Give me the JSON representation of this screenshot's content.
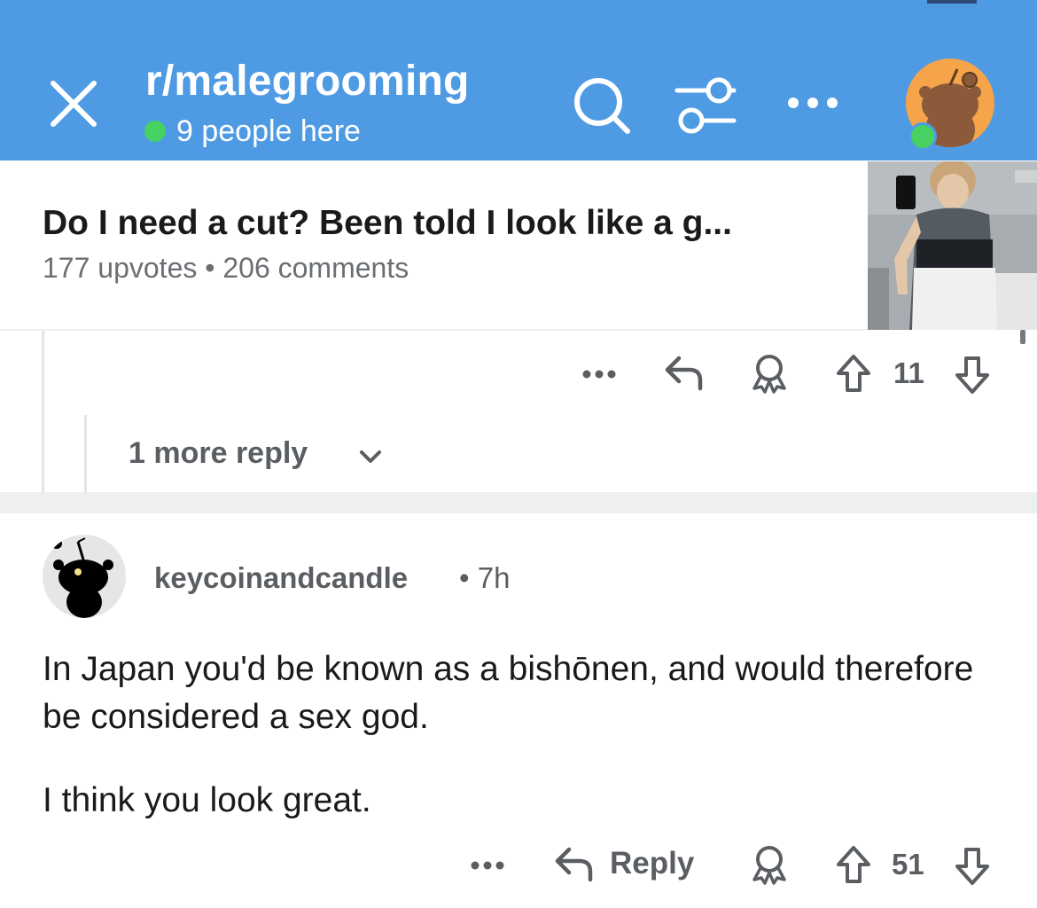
{
  "header": {
    "subreddit": "r/malegrooming",
    "online_text": "9 people here",
    "accent_color": "#4e9be4",
    "online_color": "#46d160"
  },
  "post": {
    "title": "Do I need a cut? Been told I look like a g...",
    "meta": "177 upvotes • 206 comments"
  },
  "parent_comment_actions": {
    "more": "•••",
    "upvotes": "11"
  },
  "more_replies": {
    "label": "1 more reply"
  },
  "comment": {
    "author": "keycoinandcandle",
    "time": "•  7h",
    "paragraphs": [
      "In Japan you'd be known as a bishōnen, and would therefore be considered a sex god.",
      "I think you look great."
    ],
    "actions": {
      "more": "•••",
      "reply_label": "Reply",
      "upvotes": "51"
    }
  },
  "icons": [
    "close-icon",
    "search-icon",
    "filter-icon",
    "more-icon",
    "user-avatar-icon",
    "reply-arrow-icon",
    "award-icon",
    "upvote-icon",
    "downvote-icon",
    "chevron-down-icon"
  ]
}
